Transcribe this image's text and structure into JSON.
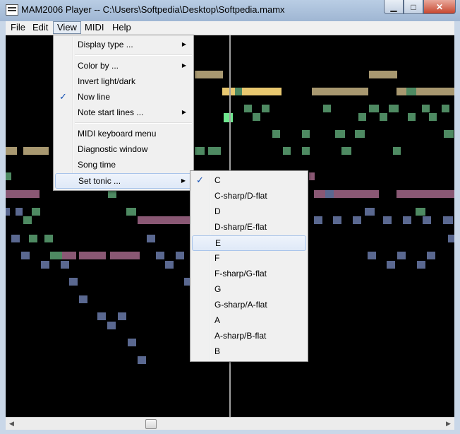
{
  "window": {
    "title": "MAM2006 Player -- C:\\Users\\Softpedia\\Desktop\\Softpedia.mamx",
    "minimize_glyph": "▁",
    "maximize_glyph": "□",
    "close_glyph": "✕"
  },
  "menubar": {
    "items": [
      {
        "label": "File"
      },
      {
        "label": "Edit"
      },
      {
        "label": "View"
      },
      {
        "label": "MIDI"
      },
      {
        "label": "Help"
      }
    ]
  },
  "view_menu": {
    "items": [
      {
        "label": "Display type ..."
      },
      {
        "label": "Color by ..."
      },
      {
        "label": "Invert light/dark"
      },
      {
        "label": "Now line"
      },
      {
        "label": "Note start lines ..."
      },
      {
        "label": "MIDI keyboard menu"
      },
      {
        "label": "Diagnostic window"
      },
      {
        "label": "Song time"
      },
      {
        "label": "Set tonic ..."
      }
    ],
    "checked_item": "Now line",
    "active_item": "Set tonic ...",
    "submenu_arrow": "▶",
    "check_glyph": "✓"
  },
  "tonic_submenu": {
    "items": [
      {
        "label": "C"
      },
      {
        "label": "C-sharp/D-flat"
      },
      {
        "label": "D"
      },
      {
        "label": "D-sharp/E-flat"
      },
      {
        "label": "E"
      },
      {
        "label": "F"
      },
      {
        "label": "F-sharp/G-flat"
      },
      {
        "label": "G"
      },
      {
        "label": "G-sharp/A-flat"
      },
      {
        "label": "A"
      },
      {
        "label": "A-sharp/B-flat"
      },
      {
        "label": "B"
      }
    ],
    "checked_item": "C",
    "hovered_item": "E",
    "check_glyph": "✓"
  },
  "scrollbar": {
    "left_arrow": "◀",
    "right_arrow": "▶"
  },
  "colors": {
    "background": "#000000",
    "now_line": "#a0a0a0",
    "note_tan": "#a89870",
    "note_green": "#4e8a62",
    "note_blue": "#5a6890",
    "note_mauve": "#8a5874",
    "note_yellow": "#e8c870",
    "note_bright_green": "#70e890",
    "menu_check": "#1450b4"
  }
}
